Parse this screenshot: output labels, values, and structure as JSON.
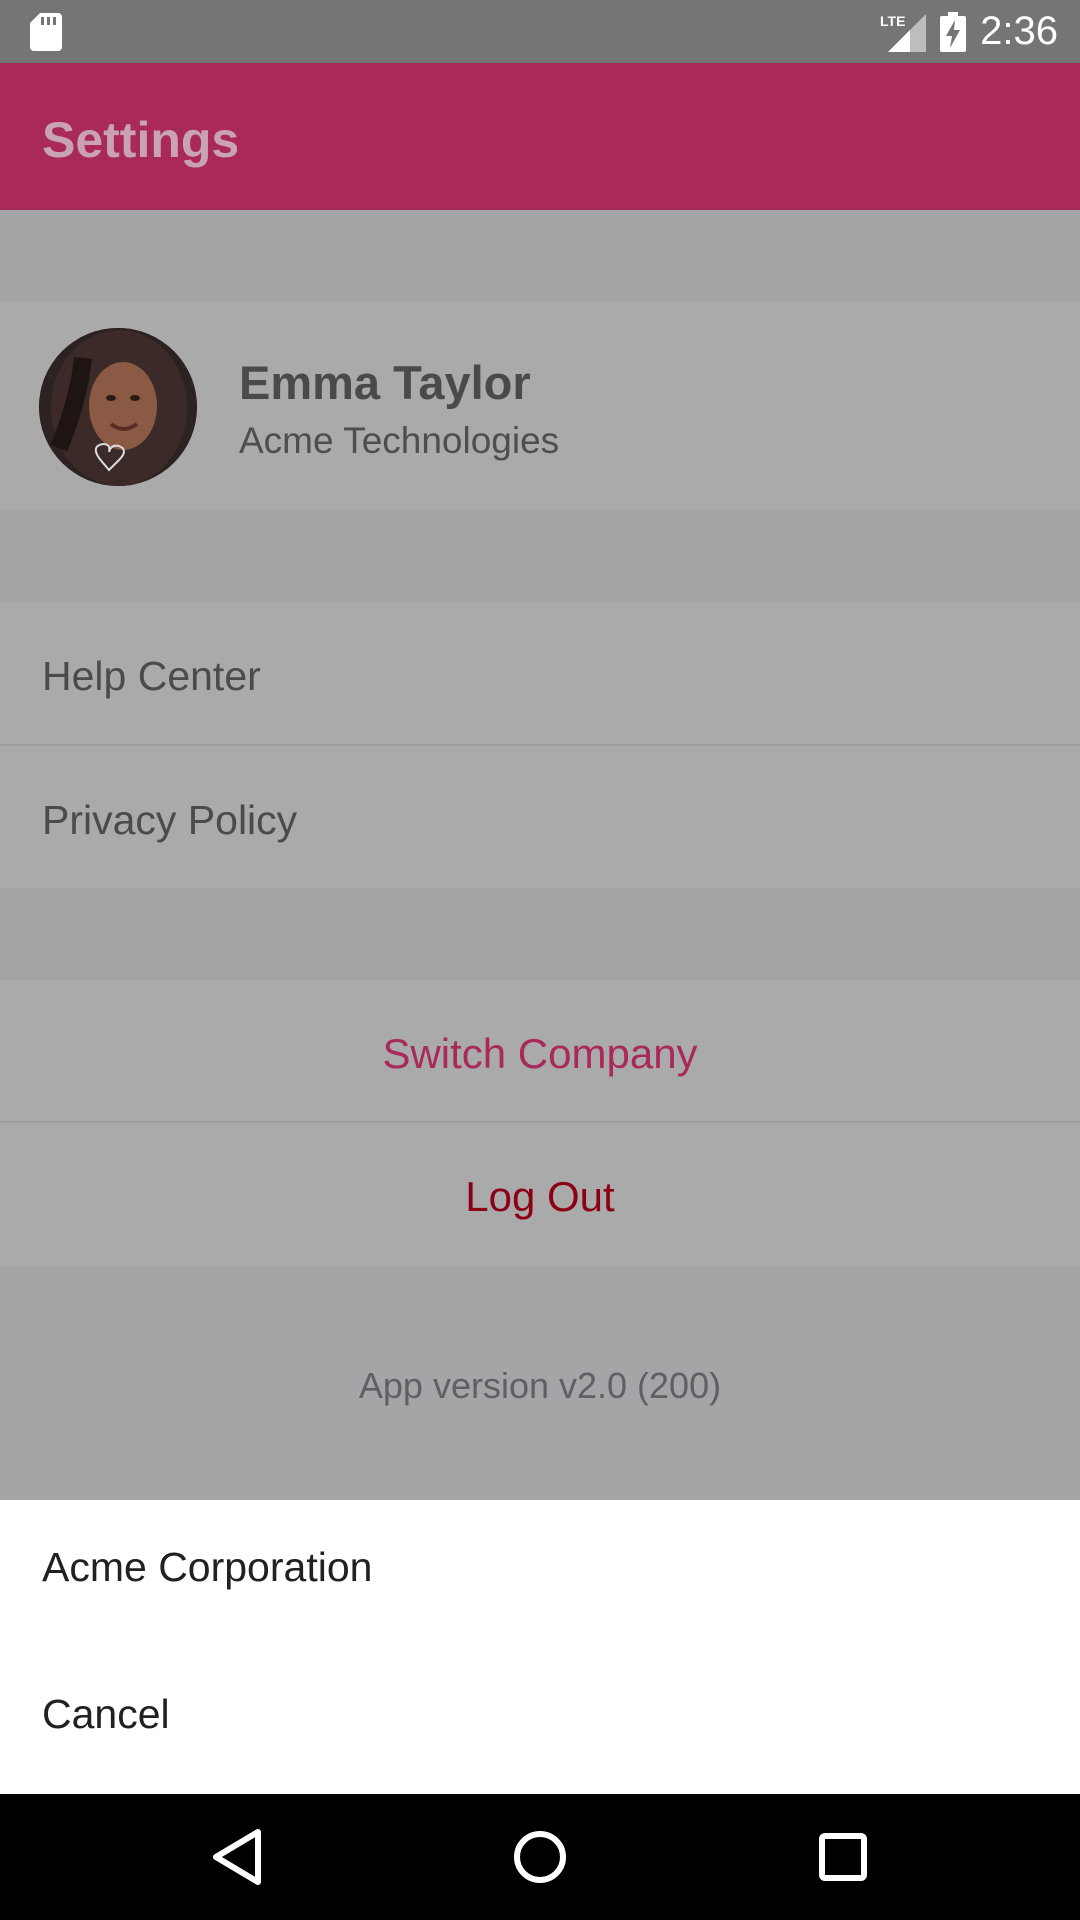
{
  "status_bar": {
    "time": "2:36",
    "network": "LTE",
    "icons": [
      "sd-card-icon",
      "lte-signal-icon",
      "battery-charging-icon"
    ]
  },
  "app_bar": {
    "title": "Settings",
    "color": "#a8295a"
  },
  "profile": {
    "name": "Emma Taylor",
    "company": "Acme Technologies"
  },
  "menu": {
    "help_center": "Help Center",
    "privacy_policy": "Privacy Policy"
  },
  "actions": {
    "switch_company": "Switch Company",
    "switch_company_color": "#a8295a",
    "log_out": "Log Out",
    "log_out_color": "#8b0014"
  },
  "footer": {
    "version": "App version v2.0 (200)"
  },
  "bottom_sheet": {
    "options": [
      "Acme Corporation"
    ],
    "cancel": "Cancel"
  },
  "nav_bar": {
    "icons": [
      "back-icon",
      "home-icon",
      "recents-icon"
    ]
  }
}
